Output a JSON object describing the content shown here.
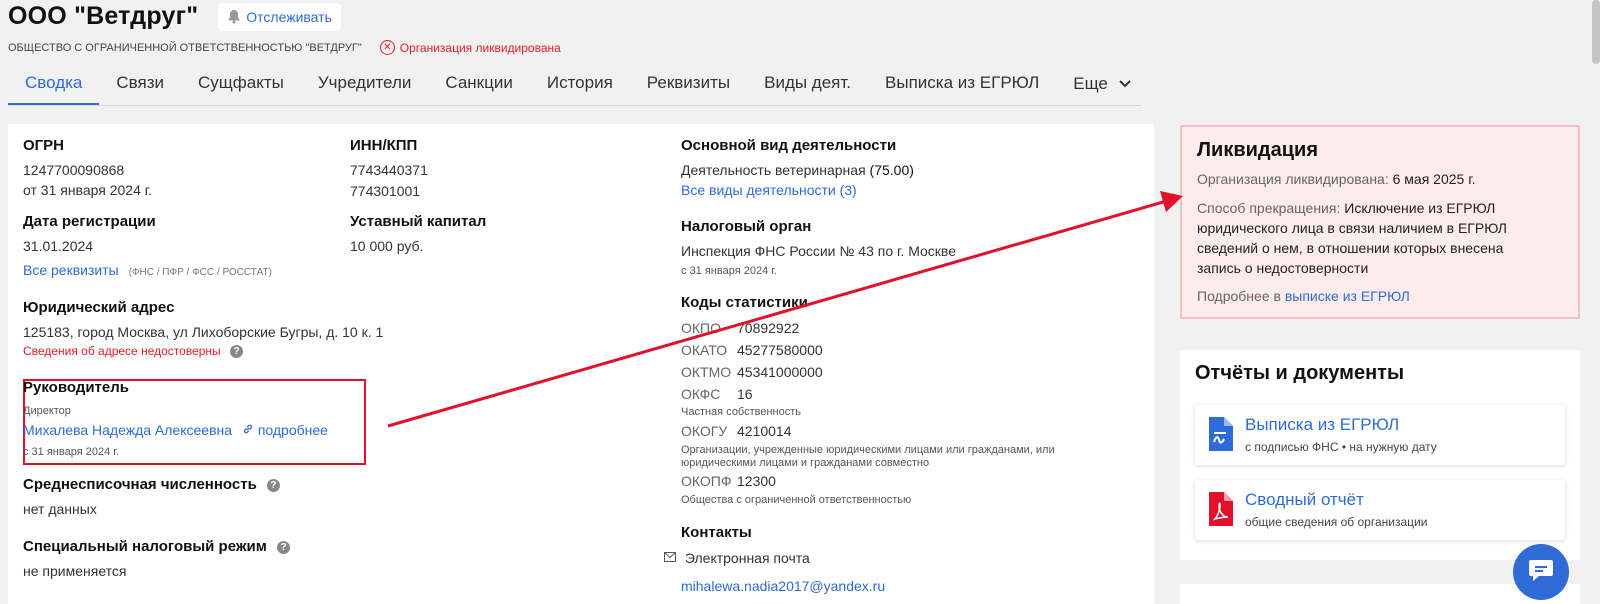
{
  "header": {
    "company_name": "ООО \"Ветдруг\"",
    "follow_label": "Отслеживать",
    "full_name": "ОБЩЕСТВО С ОГРАНИЧЕННОЙ ОТВЕТСТВЕННОСТЬЮ \"ВЕТДРУГ\"",
    "status": "Организация ликвидирована"
  },
  "tabs": [
    {
      "label": "Сводка",
      "active": true
    },
    {
      "label": "Связи"
    },
    {
      "label": "Сущфакты"
    },
    {
      "label": "Учредители"
    },
    {
      "label": "Санкции"
    },
    {
      "label": "История"
    },
    {
      "label": "Реквизиты"
    },
    {
      "label": "Виды деят."
    },
    {
      "label": "Выписка из ЕГРЮЛ"
    },
    {
      "label": "Еще"
    }
  ],
  "summary": {
    "ogrn_label": "ОГРН",
    "ogrn": "1247700090868",
    "ogrn_date": "от 31 января 2024 г.",
    "inn_label": "ИНН/КПП",
    "inn": "7743440371",
    "kpp": "774301001",
    "reg_date_label": "Дата регистрации",
    "reg_date": "31.01.2024",
    "capital_label": "Уставный капитал",
    "capital": "10 000 руб.",
    "all_requisites_link": "Все реквизиты",
    "requisites_note": "(ФНС / ПФР / ФСС / РОССТАТ)",
    "address_label": "Юридический адрес",
    "address": "125183, город Москва, ул Лихоборские Бугры, д. 10 к. 1",
    "address_warning": "Сведения об адресе недостоверны",
    "director_label": "Руководитель",
    "director_position": "Директор",
    "director_name": "Михалева Надежда Алексеевна",
    "director_more": "подробнее",
    "director_date": "с 31 января 2024 г.",
    "headcount_label": "Среднесписочная численность",
    "headcount": "нет данных",
    "tax_regime_label": "Специальный налоговый режим",
    "tax_regime": "не применяется",
    "activity_label": "Основной вид деятельности",
    "activity": "Деятельность ветеринарная",
    "activity_code": "(75.00)",
    "all_activities_link": "Все виды деятельности (3)",
    "tax_authority_label": "Налоговый орган",
    "tax_authority": "Инспекция ФНС России № 43 по г. Москве",
    "tax_authority_date": "с 31 января 2024 г.",
    "stat_codes_label": "Коды статистики",
    "okpo_key": "ОКПО",
    "okpo": "70892922",
    "okato_key": "ОКАТО",
    "okato": "45277580000",
    "oktmo_key": "ОКТМО",
    "oktmo": "45341000000",
    "okfs_key": "ОКФС",
    "okfs": "16",
    "okfs_desc": "Частная собственность",
    "okogu_key": "ОКОГУ",
    "okogu": "4210014",
    "okogu_desc_1": "Организации, учрежденные юридическими лицами или гражданами, или",
    "okogu_desc_2": "юридическими лицами и гражданами совместно",
    "okopf_key": "ОКОПФ",
    "okopf": "12300",
    "okopf_desc": "Общества с ограниченной ответственностью",
    "contacts_label": "Контакты",
    "email_label": "Электронная почта",
    "email": "mihalewa.nadia2017@yandex.ru"
  },
  "liquidation": {
    "title": "Ликвидация",
    "status_label": "Организация ликвидирована:",
    "status_date": "6 мая 2025 г.",
    "method_label": "Способ прекращения:",
    "method_1": "Исключение из ЕГРЮЛ",
    "method_2": "юридического лица в связи наличием в ЕГРЮЛ",
    "method_3": "сведений о нем, в отношении которых внесена",
    "method_4": "запись о недостоверности",
    "more_label": "Подробнее в",
    "more_link": "выписке из ЕГРЮЛ"
  },
  "documents": {
    "title": "Отчёты и документы",
    "items": [
      {
        "title": "Выписка из ЕГРЮЛ",
        "subtitle": "с подписью ФНС • на нужную дату",
        "icon": "document-icon"
      },
      {
        "title": "Сводный отчёт",
        "subtitle": "общие сведения об организации",
        "icon": "pdf-icon"
      }
    ]
  },
  "colors": {
    "accent": "#2f6bd6",
    "danger": "#e11d2a",
    "annotation": "#e3102c",
    "liquidation_bg": "#fdecec"
  }
}
